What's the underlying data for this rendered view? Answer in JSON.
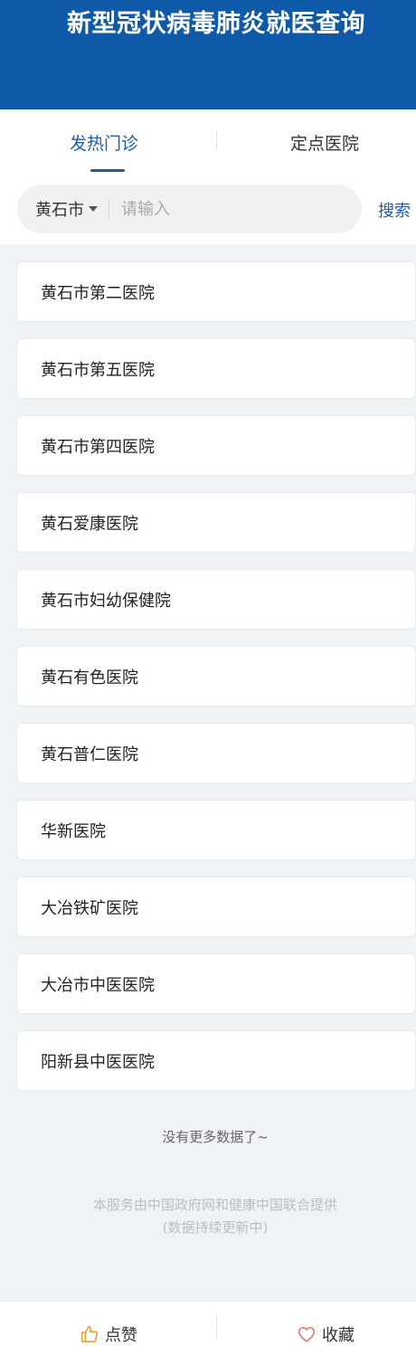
{
  "header": {
    "title": "新型冠状病毒肺炎就医查询"
  },
  "tabs": [
    {
      "label": "发热门诊",
      "active": true
    },
    {
      "label": "定点医院",
      "active": false
    }
  ],
  "search": {
    "city": "黄石市",
    "placeholder": "请输入",
    "value": "",
    "button_label": "搜索"
  },
  "hospitals": [
    "黄石市第二医院",
    "黄石市第五医院",
    "黄石市第四医院",
    "黄石爱康医院",
    "黄石市妇幼保健院",
    "黄石有色医院",
    "黄石普仁医院",
    "华新医院",
    "大冶铁矿医院",
    "大冶市中医医院",
    "阳新县中医医院"
  ],
  "list_end_text": "没有更多数据了~",
  "footer_note": {
    "line1": "本服务由中国政府网和健康中国联合提供",
    "line2": "(数据持续更新中)"
  },
  "bottom_bar": {
    "like_label": "点赞",
    "like_icon": "thumbs-up-icon",
    "favorite_label": "收藏",
    "favorite_icon": "heart-icon"
  },
  "colors": {
    "header_bg": "#0f5aa8",
    "accent": "#1d5fa5",
    "like_icon": "#e8a33c",
    "favorite_icon": "#e07b7b"
  }
}
